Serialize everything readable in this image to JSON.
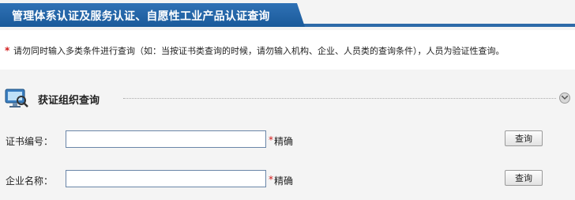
{
  "header": {
    "title": "管理体系认证及服务认证、自愿性工业产品认证查询"
  },
  "notice": {
    "marker": "*",
    "text": "请勿同时输入多类条件进行查询（如：当按证书类查询的时候，请勿输入机构、企业、人员类的查询条件），人员为验证性查询。"
  },
  "section": {
    "title": "获证组织查询",
    "icon": "monitor-search-icon",
    "toggle_icon": "chevron-down-icon"
  },
  "form": {
    "rows": [
      {
        "label": "证书编号：",
        "value": "",
        "required_marker": "*",
        "match_mode": "精确",
        "button": "查询"
      },
      {
        "label": "企业名称：",
        "value": "",
        "required_marker": "*",
        "match_mode": "精确",
        "button": "查询"
      }
    ]
  },
  "colors": {
    "title_bar": "#1f609f",
    "accent_red": "#d21919",
    "input_border": "#6a86a8"
  }
}
